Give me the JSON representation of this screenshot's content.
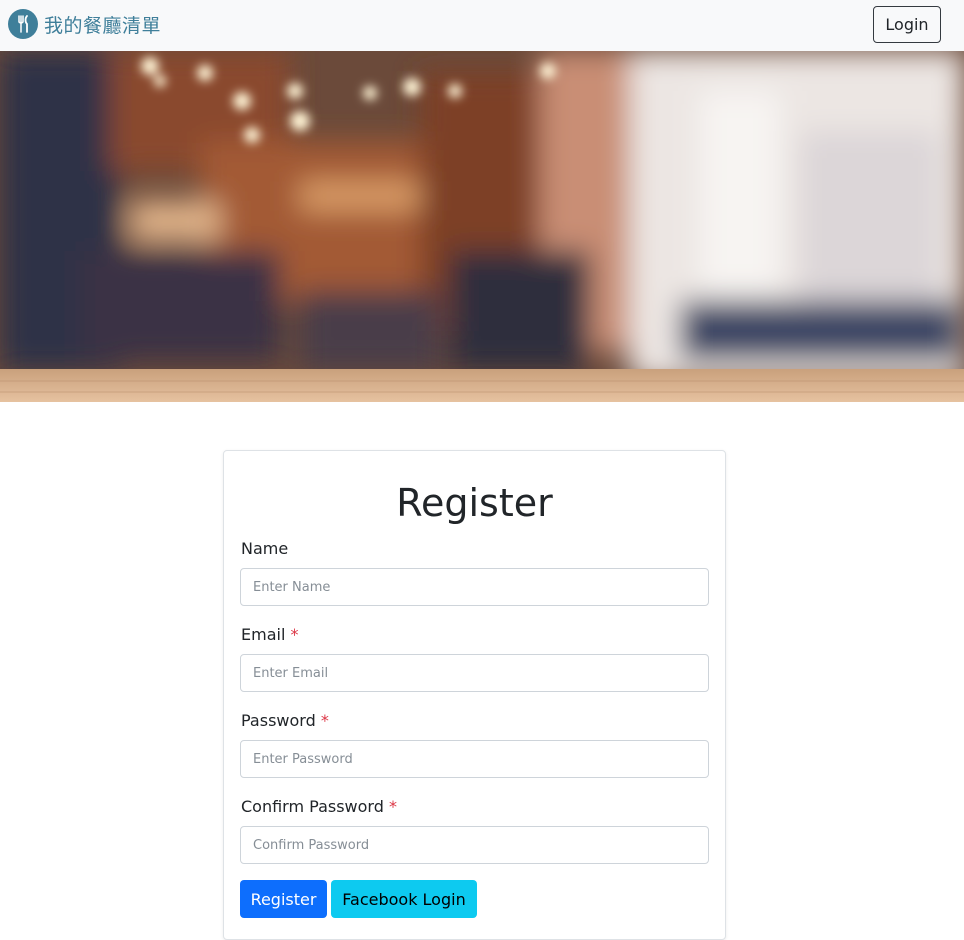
{
  "navbar": {
    "brand_text": "我的餐廳清單",
    "brand_icon": "fork-knife-icon",
    "login_label": "Login"
  },
  "hero": {
    "image": "blurred-restaurant-interior"
  },
  "register_form": {
    "title": "Register",
    "fields": [
      {
        "label": "Name",
        "required": false,
        "placeholder": "Enter Name",
        "value": ""
      },
      {
        "label": "Email",
        "required": true,
        "placeholder": "Enter Email",
        "value": ""
      },
      {
        "label": "Password",
        "required": true,
        "placeholder": "Enter Password",
        "value": ""
      },
      {
        "label": "Confirm Password",
        "required": true,
        "placeholder": "Confirm Password",
        "value": ""
      }
    ],
    "required_marker": "*",
    "register_button": "Register",
    "facebook_button": "Facebook Login"
  },
  "colors": {
    "brand": "#3f7f9a",
    "primary": "#0d6efd",
    "info": "#0dcaf0",
    "required": "#dc3545",
    "navbar_bg": "#f8f9fa"
  }
}
